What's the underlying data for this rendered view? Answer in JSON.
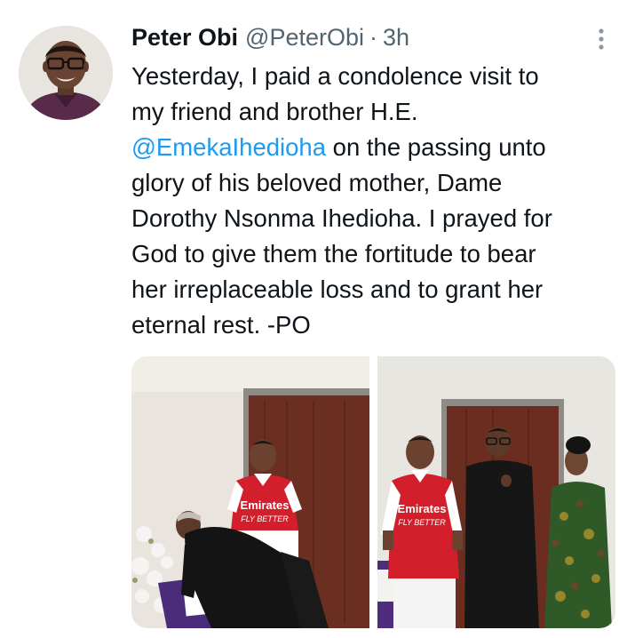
{
  "tweet": {
    "author_name": "Peter Obi",
    "author_handle": "@PeterObi",
    "separator": "·",
    "time": "3h",
    "more_icon": "more-vertical-icon",
    "text_lines": [
      {
        "pre": "Yesterday, I paid a condolence visit to",
        "mention": "",
        "post": ""
      },
      {
        "pre": "my friend and brother H.E.",
        "mention": "",
        "post": ""
      },
      {
        "pre": "",
        "mention": "@EmekaIhedioha",
        "post": " on the passing unto"
      },
      {
        "pre": "glory of his beloved mother, Dame",
        "mention": "",
        "post": ""
      },
      {
        "pre": "Dorothy Nsonma Ihedioha. I prayed for",
        "mention": "",
        "post": ""
      },
      {
        "pre": "God to give them the fortitude to bear",
        "mention": "",
        "post": ""
      },
      {
        "pre": "her irreplaceable loss and to grant her",
        "mention": "",
        "post": ""
      },
      {
        "pre": "eternal rest. -PO",
        "mention": "",
        "post": ""
      }
    ],
    "photos": [
      {
        "jersey_line1": "Emirates",
        "jersey_line2": "FLY BETTER"
      },
      {
        "jersey_line1": "Emirates",
        "jersey_line2": "FLY BETTER"
      }
    ],
    "colors": {
      "text": "#0f1419",
      "muted": "#536471",
      "link": "#1d9bf0",
      "jersey_red": "#d21f2b"
    }
  }
}
